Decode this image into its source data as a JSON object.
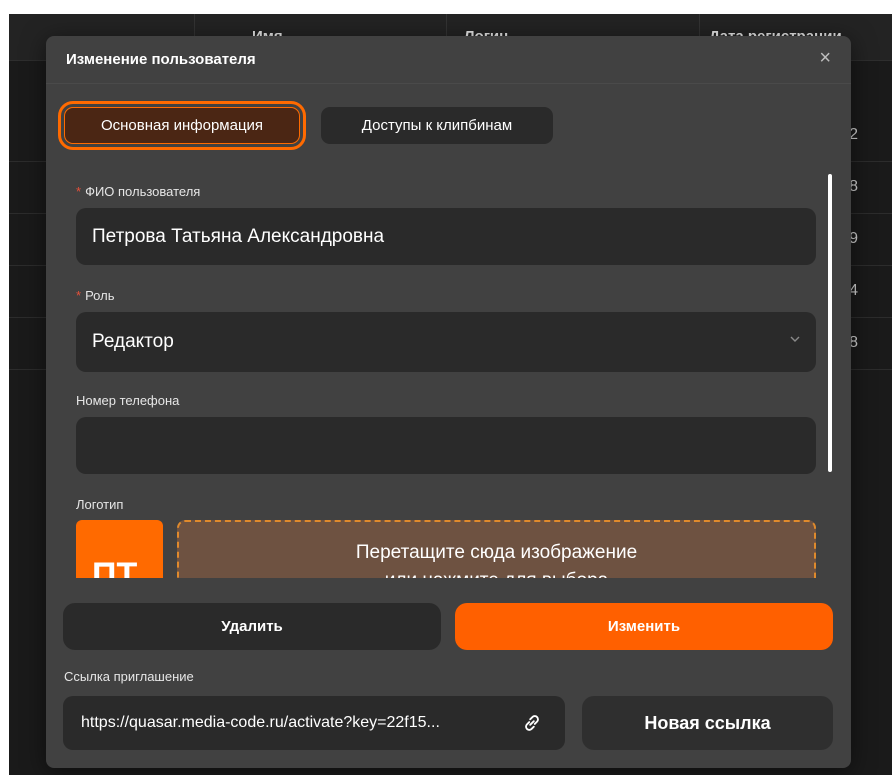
{
  "backdrop": {
    "columns": [
      "Имя",
      "Логин",
      "Дата регистрации"
    ],
    "row_digits": [
      "2",
      "8",
      "9",
      "4",
      "8"
    ]
  },
  "modal": {
    "title": "Изменение пользователя",
    "close_symbol": "×",
    "tabs": [
      {
        "label": "Основная информация",
        "active": true
      },
      {
        "label": "Доступы к клипбинам",
        "active": false
      }
    ]
  },
  "form": {
    "full_name": {
      "label": "ФИО пользователя",
      "required": true,
      "value": "Петрова Татьяна Александровна"
    },
    "role": {
      "label": "Роль",
      "required": true,
      "value": "Редактор"
    },
    "phone": {
      "label": "Номер телефона",
      "value": ""
    },
    "logo": {
      "label": "Логотип",
      "initials": "ПТ",
      "dropzone_line1": "Перетащите сюда изображение",
      "dropzone_line2": "или нажмите для выбора"
    }
  },
  "actions": {
    "delete_label": "Удалить",
    "edit_label": "Изменить"
  },
  "invite": {
    "label": "Ссылка приглашение",
    "url": "https://quasar.media-code.ru/activate?key=22f15...",
    "new_link_label": "Новая ссылка"
  },
  "icons": {
    "close": "close-icon",
    "dropdown": "chevron-down-icon",
    "link": "link-icon"
  },
  "colors": {
    "accent": "#ff6000",
    "required": "#e5503a",
    "modal_bg": "#414141",
    "field_bg": "#2a2a2a"
  }
}
